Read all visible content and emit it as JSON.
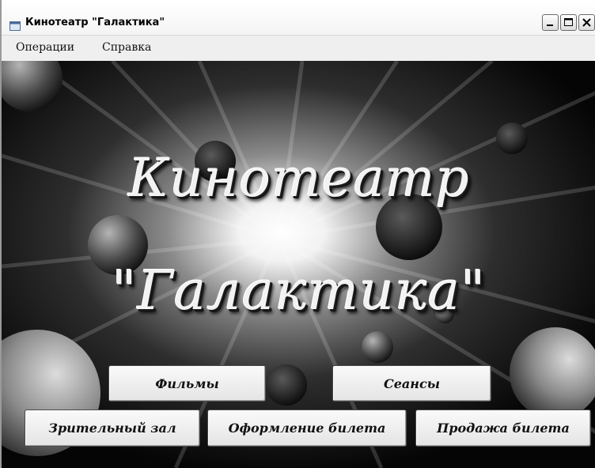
{
  "window": {
    "title": "Кинотеатр \"Галактика\"",
    "icon": "app-window-icon",
    "controls": [
      "minimize-icon",
      "maximize-icon",
      "close-icon"
    ]
  },
  "menu": {
    "items": [
      {
        "label": "Операции"
      },
      {
        "label": "Справка"
      }
    ]
  },
  "banner": {
    "line1": "Кинотеатр",
    "line2": "\"Галактика\""
  },
  "buttons": {
    "films": "Фильмы",
    "sessions": "Сеансы",
    "hall": "Зрительный зал",
    "ticket_registration": "Оформление билета",
    "ticket_sale": "Продажа билета"
  },
  "colors": {
    "background": "#0a0a0a",
    "headline": "#f2f2f2",
    "button_face": "#efefef"
  }
}
